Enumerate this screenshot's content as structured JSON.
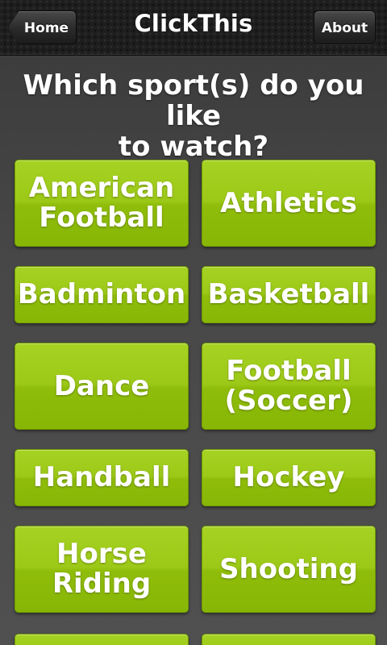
{
  "navbar": {
    "title": "ClickThis",
    "home_label": "Home",
    "about_label": "About"
  },
  "question": {
    "line1": "Which sport(s) do you like",
    "line2": "to watch?"
  },
  "sports": [
    {
      "line1": "American",
      "line2": "Football"
    },
    {
      "line1": "Athletics"
    },
    {
      "line1": "Badminton"
    },
    {
      "line1": "Basketball"
    },
    {
      "line1": "Dance"
    },
    {
      "line1": "Football",
      "line2": "(Soccer)"
    },
    {
      "line1": "Handball"
    },
    {
      "line1": "Hockey"
    },
    {
      "line1": "Horse",
      "line2": "Riding"
    },
    {
      "line1": "Shooting"
    }
  ],
  "colors": {
    "button_green": "#9cc817",
    "navbar": "#1e1e1e",
    "background": "#474747",
    "text": "#ffffff"
  }
}
